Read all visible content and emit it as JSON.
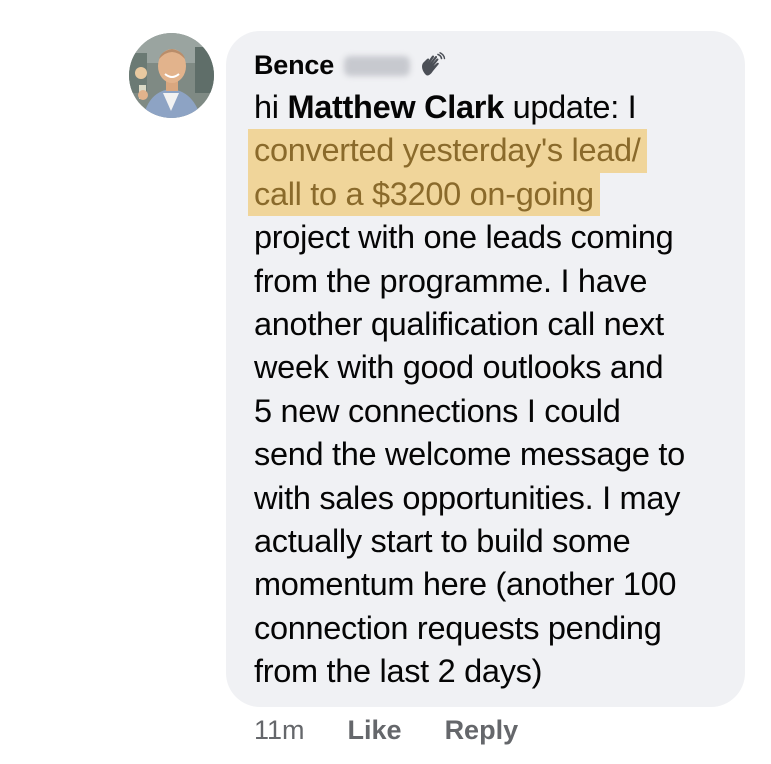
{
  "comment": {
    "author_first_name": "Bence",
    "author_last_name_blurred": "",
    "badge_icon": "waving-hand-icon",
    "lines": [
      {
        "pre": "hi ",
        "mention": "Matthew Clark",
        "post": " update: I"
      },
      {
        "highlight": "converted yesterday's lead/"
      },
      {
        "highlight": "call to a $3200 on-going"
      },
      {
        "text": "project with one leads coming"
      },
      {
        "text": "from the programme. I have"
      },
      {
        "text": "another qualification call next"
      },
      {
        "text": "week with good outlooks and"
      },
      {
        "text": "5 new connections I could"
      },
      {
        "text": "send the welcome message to"
      },
      {
        "text": "with sales opportunities. I may"
      },
      {
        "text": "actually start to build some"
      },
      {
        "text": "momentum here (another 100"
      },
      {
        "text": "connection requests pending"
      },
      {
        "text": "from the last 2 days)"
      }
    ]
  },
  "actions": {
    "timestamp": "11m",
    "like_label": "Like",
    "reply_label": "Reply"
  },
  "colors": {
    "bubble_bg": "#f0f1f4",
    "highlight_bg": "#f0d59a",
    "highlight_text": "#8a6a2b",
    "meta_text": "#65676b"
  }
}
